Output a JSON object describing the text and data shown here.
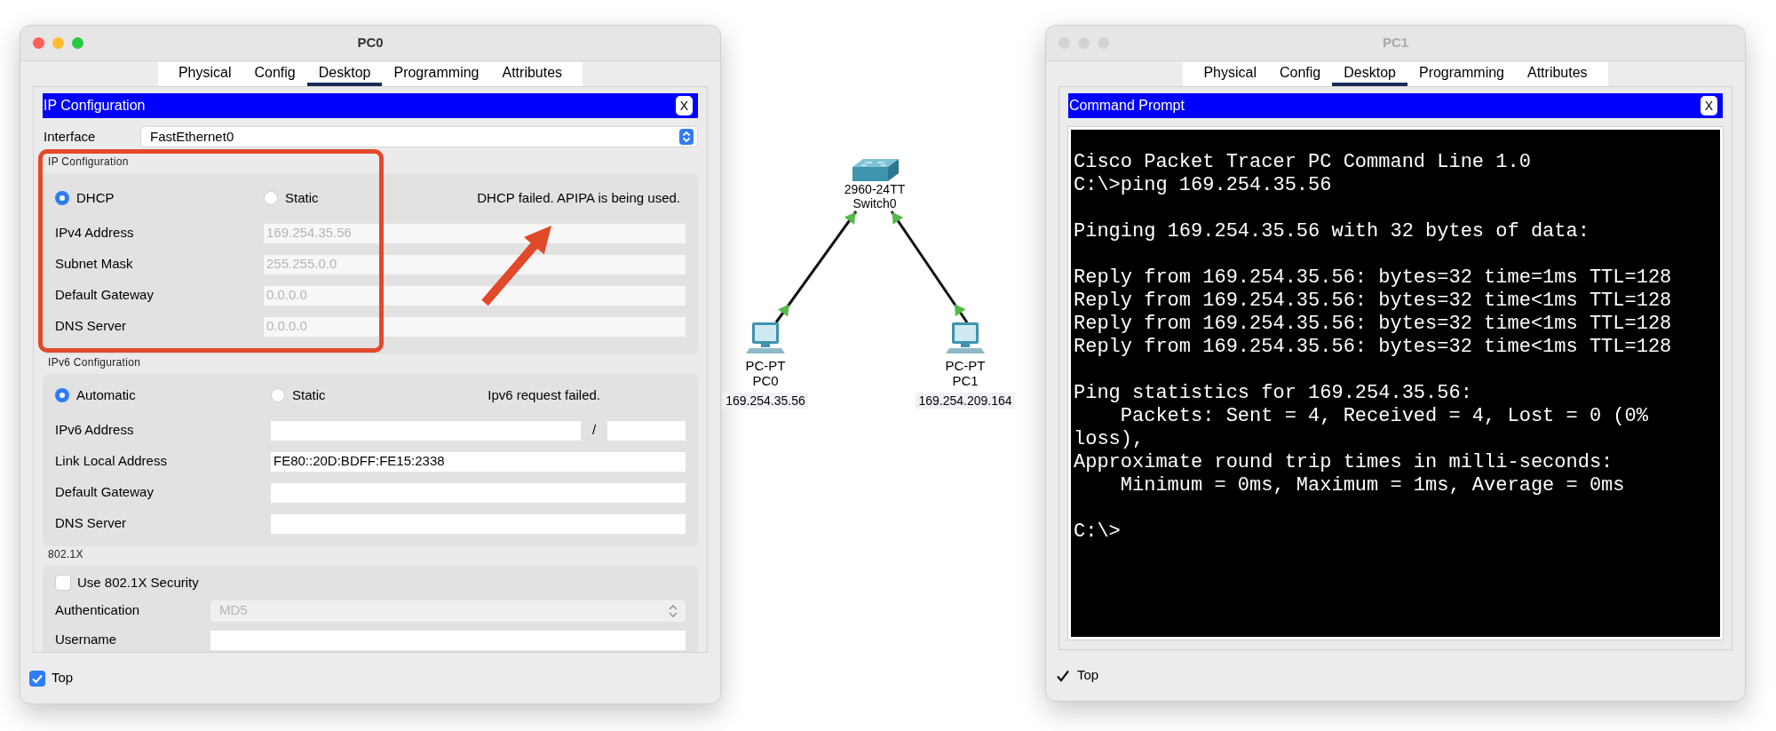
{
  "pc0_window": {
    "title": "PC0",
    "active": true,
    "tabs": [
      {
        "label": "Physical",
        "selected": false
      },
      {
        "label": "Config",
        "selected": false
      },
      {
        "label": "Desktop",
        "selected": true
      },
      {
        "label": "Programming",
        "selected": false
      },
      {
        "label": "Attributes",
        "selected": false
      }
    ],
    "panel": {
      "kind": "ip_config",
      "title": "IP Configuration",
      "close": "X",
      "interface": {
        "label": "Interface",
        "value": "FastEthernet0"
      },
      "ipv4": {
        "heading": "IP Configuration",
        "modes": [
          {
            "label": "DHCP",
            "selected": true
          },
          {
            "label": "Static",
            "selected": false
          }
        ],
        "status": "DHCP failed. APIPA is being used.",
        "fields": [
          {
            "label": "IPv4 Address",
            "value": "169.254.35.56",
            "disabled": true
          },
          {
            "label": "Subnet Mask",
            "value": "255.255.0.0",
            "disabled": true
          },
          {
            "label": "Default Gateway",
            "value": "0.0.0.0",
            "disabled": true
          },
          {
            "label": "DNS Server",
            "value": "0.0.0.0",
            "disabled": true
          }
        ]
      },
      "ipv6": {
        "heading": "IPv6 Configuration",
        "modes": [
          {
            "label": "Automatic",
            "selected": true
          },
          {
            "label": "Static",
            "selected": false
          }
        ],
        "status": "Ipv6 request failed.",
        "fields": [
          {
            "label": "IPv6 Address",
            "kind": "prefix",
            "separator": "/"
          },
          {
            "label": "Link Local Address",
            "kind": "text",
            "value": "FE80::20D:BDFF:FE15:2338"
          },
          {
            "label": "Default Gateway",
            "kind": "text"
          },
          {
            "label": "DNS Server",
            "kind": "text"
          }
        ]
      },
      "dot1x": {
        "heading": "802.1X",
        "security": {
          "label": "Use 802.1X Security",
          "checked": false
        },
        "fields": [
          {
            "label": "Authentication",
            "kind": "select",
            "value": "MD5",
            "disabled": true
          },
          {
            "label": "Username",
            "kind": "text"
          }
        ]
      }
    },
    "top": {
      "label": "Top",
      "checked": true
    }
  },
  "topology": {
    "devices": [
      {
        "kind": "switch",
        "model": "2960-24TT",
        "name": "Switch0"
      },
      {
        "kind": "pc",
        "model": "PC-PT",
        "name": "PC0",
        "ip": "169.254.35.56",
        "link_up": true
      },
      {
        "kind": "pc",
        "model": "PC-PT",
        "name": "PC1",
        "ip": "169.254.209.164",
        "link_up": true
      }
    ]
  },
  "pc1_window": {
    "title": "PC1",
    "active": false,
    "tabs": [
      {
        "label": "Physical",
        "selected": false
      },
      {
        "label": "Config",
        "selected": false
      },
      {
        "label": "Desktop",
        "selected": true
      },
      {
        "label": "Programming",
        "selected": false
      },
      {
        "label": "Attributes",
        "selected": false
      }
    ],
    "panel": {
      "kind": "command_prompt",
      "title": "Command Prompt",
      "close": "X",
      "terminal": [
        [
          "Cisco Packet Tracer PC Command Line 1.0",
          "C:\\>ping 169.254.35.56"
        ],
        [
          "Pinging 169.254.35.56 with 32 bytes of data:"
        ],
        [
          "Reply from 169.254.35.56: bytes=32 time=1ms TTL=128",
          "Reply from 169.254.35.56: bytes=32 time<1ms TTL=128",
          "Reply from 169.254.35.56: bytes=32 time<1ms TTL=128",
          "Reply from 169.254.35.56: bytes=32 time<1ms TTL=128"
        ],
        [
          "Ping statistics for 169.254.35.56:",
          "    Packets: Sent = 4, Received = 4, Lost = 0 (0%",
          "loss),",
          "Approximate round trip times in milli-seconds:",
          "    Minimum = 0ms, Maximum = 1ms, Average = 0ms"
        ],
        [
          "C:\\>"
        ]
      ]
    },
    "top": {
      "label": "Top",
      "checked": true
    }
  }
}
